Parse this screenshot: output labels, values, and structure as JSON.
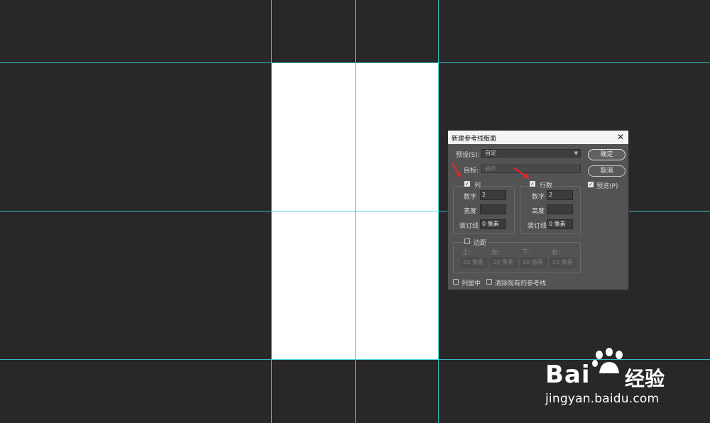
{
  "dialog": {
    "title": "新建参考线版面",
    "close_glyph": "✕",
    "preset_label": "预设(S):",
    "preset_value": "自定",
    "target_label": "目标:",
    "target_value": "画布",
    "ok_label": "确定",
    "cancel_label": "取消",
    "preview_label": "预览(P)",
    "columns": {
      "label": "列",
      "checked": true,
      "number_label": "数字",
      "number_value": "2",
      "width_label": "宽度",
      "width_value": "",
      "gutter_label": "装订线",
      "gutter_value": "0 像素"
    },
    "rows": {
      "label": "行数",
      "checked": true,
      "number_label": "数字",
      "number_value": "2",
      "height_label": "高度",
      "height_value": "",
      "gutter_label": "装订线",
      "gutter_value": "0 像素"
    },
    "margin": {
      "label": "边距",
      "checked": false,
      "top_label": "上:",
      "left_label": "左:",
      "bottom_label": "下:",
      "right_label": "右:",
      "top_value": "20 像素",
      "left_value": "20 像素",
      "bottom_value": "20 像素",
      "right_value": "20 像素"
    },
    "center_columns_label": "列居中",
    "clear_guides_label": "清除现有的参考线"
  },
  "watermark": {
    "brand": "Bai",
    "brand_suffix": "经验",
    "url": "jingyan.baidu.com"
  },
  "colors": {
    "workspace": "#282828",
    "guide": "#36d4dc",
    "dialog_bg": "#535353",
    "arrow": "#e8262b"
  }
}
